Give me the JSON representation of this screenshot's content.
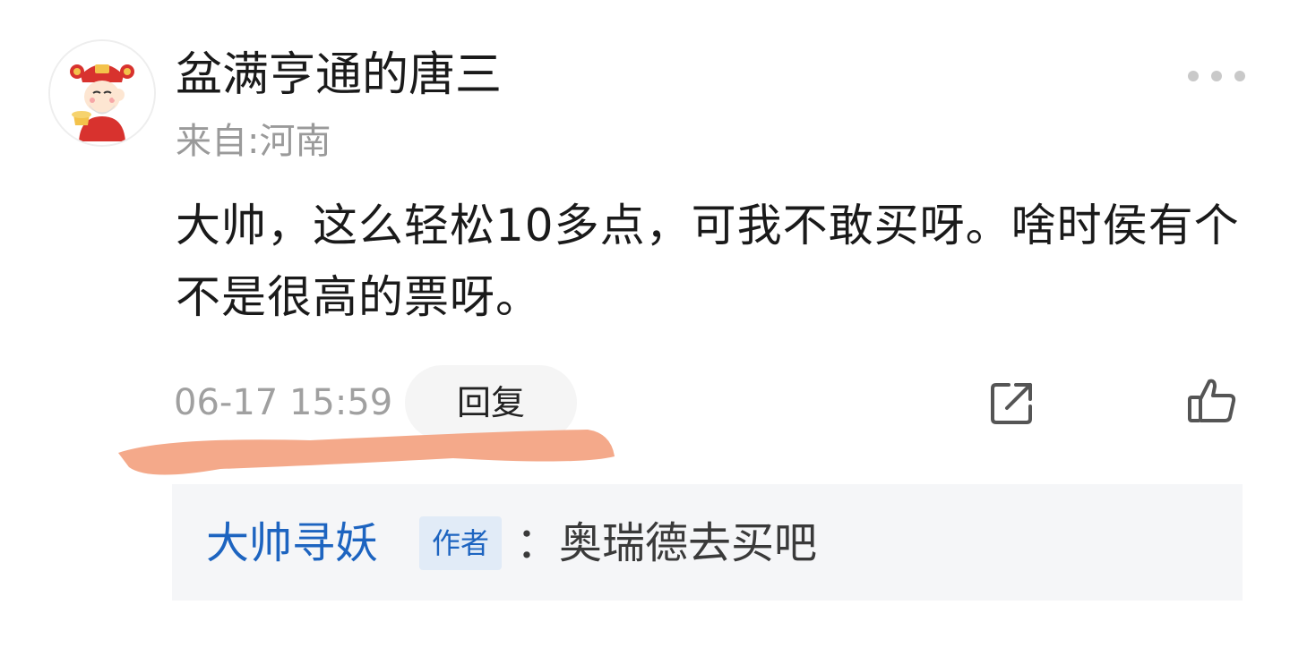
{
  "comment": {
    "username": "盆满亨通的唐三",
    "location": "来自:河南",
    "text": "大帅，这么轻松10多点，可我不敢买呀。啥时侯有个不是很高的票呀。",
    "timestamp": "06-17 15:59",
    "reply_label": "回复"
  },
  "reply": {
    "author": "大帅寻妖",
    "badge": "作者",
    "text": "：奥瑞德去买吧"
  },
  "icons": {
    "avatar": "caishen-avatar-icon",
    "more": "more-dots-icon",
    "share": "share-icon",
    "like": "thumbs-up-icon"
  },
  "colors": {
    "author_blue": "#1d64c0",
    "highlight_stroke": "#f4a98a",
    "reply_background": "#f5f6f8"
  }
}
